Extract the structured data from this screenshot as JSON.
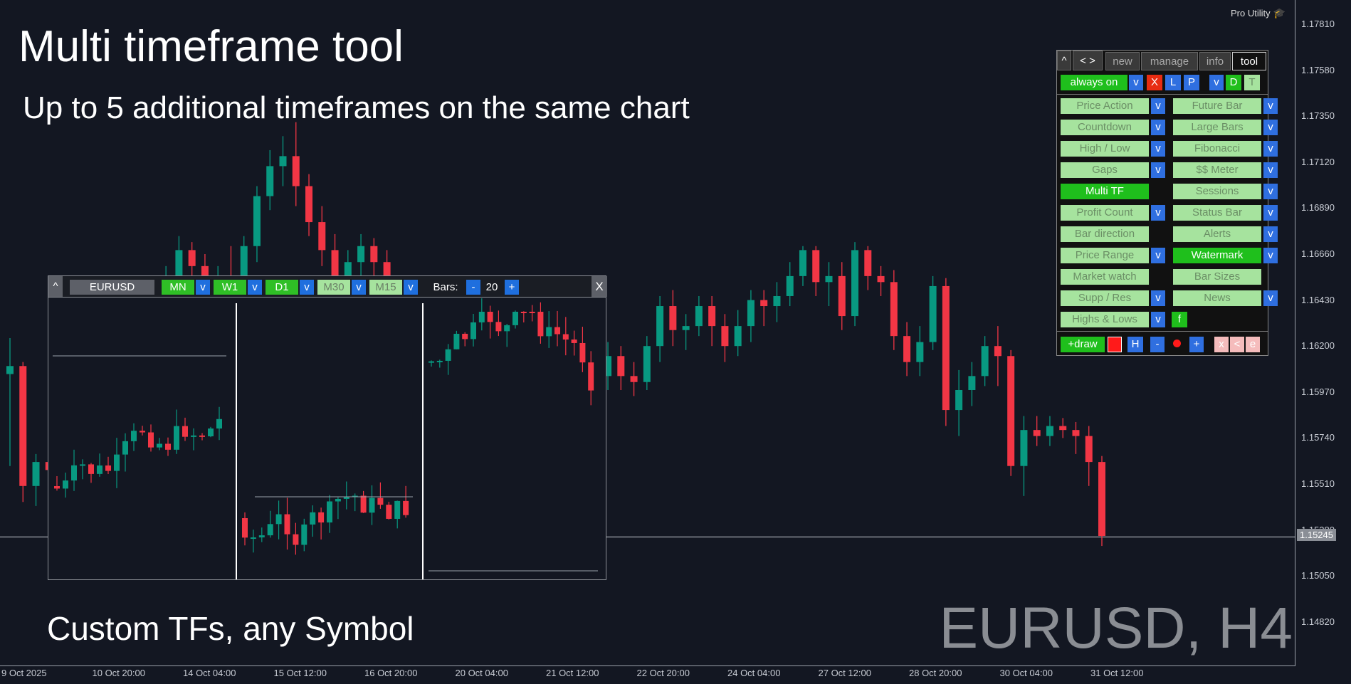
{
  "overlay": {
    "title": "Multi timeframe tool",
    "subtitle": "Up to 5 additional timeframes on the same chart",
    "caption": "Custom TFs, any Symbol",
    "watermark": "EURUSD, H4",
    "brand": "Pro Utility",
    "brand_icon": "graduation-cap-icon"
  },
  "price_axis": {
    "labels": [
      "1.17810",
      "1.17580",
      "1.17350",
      "1.17120",
      "1.16890",
      "1.16660",
      "1.16430",
      "1.16200",
      "1.15970",
      "1.15740",
      "1.15510",
      "1.15280",
      "1.15050",
      "1.14820"
    ],
    "current_price": "1.15245"
  },
  "time_axis": {
    "labels": [
      "9 Oct 2025",
      "10 Oct 20:00",
      "14 Oct 04:00",
      "15 Oct 12:00",
      "16 Oct 20:00",
      "20 Oct 04:00",
      "21 Oct 12:00",
      "22 Oct 20:00",
      "24 Oct 04:00",
      "27 Oct 12:00",
      "28 Oct 20:00",
      "30 Oct 04:00",
      "31 Oct 12:00"
    ]
  },
  "chart_data": {
    "type": "candlestick",
    "symbol": "EURUSD",
    "timeframe": "H4",
    "ylim": [
      1.147,
      1.18
    ],
    "current_price": 1.15245,
    "candles": [
      [
        1.1606,
        1.1624,
        1.156,
        1.161
      ],
      [
        1.161,
        1.1612,
        1.1542,
        1.155
      ],
      [
        1.155,
        1.1566,
        1.154,
        1.1562
      ],
      [
        1.1562,
        1.157,
        1.1552,
        1.1558
      ],
      [
        1.1558,
        1.1572,
        1.1555,
        1.1568
      ],
      [
        1.1568,
        1.1603,
        1.1565,
        1.16
      ],
      [
        1.16,
        1.1612,
        1.159,
        1.1595
      ],
      [
        1.1595,
        1.161,
        1.1596,
        1.1605
      ],
      [
        1.1605,
        1.162,
        1.1598,
        1.1612
      ],
      [
        1.1612,
        1.1628,
        1.1605,
        1.162
      ],
      [
        1.162,
        1.163,
        1.1612,
        1.1615
      ],
      [
        1.1615,
        1.164,
        1.161,
        1.1635
      ],
      [
        1.1635,
        1.166,
        1.1625,
        1.165
      ],
      [
        1.165,
        1.1675,
        1.164,
        1.1668
      ],
      [
        1.1668,
        1.1672,
        1.1645,
        1.166
      ],
      [
        1.166,
        1.1666,
        1.163,
        1.164
      ],
      [
        1.164,
        1.166,
        1.1635,
        1.1655
      ],
      [
        1.1655,
        1.167,
        1.1645,
        1.165
      ],
      [
        1.165,
        1.1675,
        1.1648,
        1.167
      ],
      [
        1.167,
        1.17,
        1.1662,
        1.1695
      ],
      [
        1.1695,
        1.1718,
        1.1688,
        1.171
      ],
      [
        1.171,
        1.1725,
        1.17,
        1.1715
      ],
      [
        1.1715,
        1.1732,
        1.169,
        1.17
      ],
      [
        1.17,
        1.1706,
        1.1675,
        1.1682
      ],
      [
        1.1682,
        1.169,
        1.166,
        1.1668
      ],
      [
        1.1668,
        1.1676,
        1.1645,
        1.165
      ],
      [
        1.165,
        1.1668,
        1.164,
        1.1662
      ],
      [
        1.1662,
        1.1676,
        1.165,
        1.167
      ],
      [
        1.167,
        1.1674,
        1.165,
        1.1662
      ],
      [
        1.1662,
        1.1668,
        1.1635,
        1.1642
      ],
      [
        1.1642,
        1.165,
        1.1622,
        1.163
      ],
      [
        1.163,
        1.164,
        1.161,
        1.1618
      ],
      [
        1.1618,
        1.1622,
        1.1592,
        1.16
      ],
      [
        1.16,
        1.1604,
        1.1578,
        1.1585
      ],
      [
        1.1585,
        1.159,
        1.156,
        1.1572
      ],
      [
        1.1572,
        1.158,
        1.155,
        1.156
      ],
      [
        1.156,
        1.1596,
        1.1555,
        1.159
      ],
      [
        1.159,
        1.1625,
        1.1585,
        1.162
      ],
      [
        1.162,
        1.1624,
        1.16,
        1.161
      ],
      [
        1.161,
        1.1616,
        1.1592,
        1.16
      ],
      [
        1.16,
        1.1605,
        1.1582,
        1.1592
      ],
      [
        1.1592,
        1.16,
        1.1575,
        1.1588
      ],
      [
        1.1588,
        1.1596,
        1.158,
        1.1592
      ],
      [
        1.1592,
        1.1604,
        1.1585,
        1.1598
      ],
      [
        1.1598,
        1.1615,
        1.1592,
        1.161
      ],
      [
        1.161,
        1.1616,
        1.1598,
        1.1605
      ],
      [
        1.1605,
        1.1622,
        1.1598,
        1.1615
      ],
      [
        1.1615,
        1.162,
        1.1598,
        1.1605
      ],
      [
        1.1605,
        1.1612,
        1.1595,
        1.1602
      ],
      [
        1.1602,
        1.1625,
        1.1598,
        1.162
      ],
      [
        1.162,
        1.1645,
        1.1612,
        1.164
      ],
      [
        1.164,
        1.1648,
        1.162,
        1.1628
      ],
      [
        1.1628,
        1.1636,
        1.1618,
        1.163
      ],
      [
        1.163,
        1.1645,
        1.1625,
        1.164
      ],
      [
        1.164,
        1.1645,
        1.162,
        1.163
      ],
      [
        1.163,
        1.1636,
        1.1612,
        1.162
      ],
      [
        1.162,
        1.1638,
        1.1615,
        1.163
      ],
      [
        1.163,
        1.1648,
        1.1622,
        1.1643
      ],
      [
        1.1643,
        1.1648,
        1.163,
        1.164
      ],
      [
        1.164,
        1.1652,
        1.1632,
        1.1645
      ],
      [
        1.1645,
        1.1662,
        1.164,
        1.1655
      ],
      [
        1.1655,
        1.167,
        1.165,
        1.1668
      ],
      [
        1.1668,
        1.167,
        1.1645,
        1.1652
      ],
      [
        1.1652,
        1.1662,
        1.164,
        1.1655
      ],
      [
        1.1655,
        1.1662,
        1.1628,
        1.1635
      ],
      [
        1.1635,
        1.1672,
        1.163,
        1.1668
      ],
      [
        1.1668,
        1.167,
        1.1648,
        1.1655
      ],
      [
        1.1655,
        1.166,
        1.1645,
        1.1652
      ],
      [
        1.1652,
        1.1658,
        1.1618,
        1.1625
      ],
      [
        1.1625,
        1.1632,
        1.1605,
        1.1612
      ],
      [
        1.1612,
        1.163,
        1.1605,
        1.1622
      ],
      [
        1.1622,
        1.1655,
        1.1618,
        1.165
      ],
      [
        1.165,
        1.1654,
        1.158,
        1.1588
      ],
      [
        1.1588,
        1.1608,
        1.1575,
        1.1598
      ],
      [
        1.1598,
        1.1612,
        1.159,
        1.1605
      ],
      [
        1.1605,
        1.1625,
        1.16,
        1.162
      ],
      [
        1.162,
        1.163,
        1.16,
        1.1615
      ],
      [
        1.1615,
        1.1618,
        1.1555,
        1.156
      ],
      [
        1.156,
        1.1585,
        1.1545,
        1.1578
      ],
      [
        1.1578,
        1.1585,
        1.157,
        1.1575
      ],
      [
        1.1575,
        1.1585,
        1.157,
        1.158
      ],
      [
        1.158,
        1.1584,
        1.1574,
        1.1578
      ],
      [
        1.1578,
        1.1582,
        1.1566,
        1.1575
      ],
      [
        1.1575,
        1.158,
        1.155,
        1.1562
      ],
      [
        1.1562,
        1.1565,
        1.152,
        1.1525
      ]
    ]
  },
  "mtf_window": {
    "symbol": "EURUSD",
    "bars_label": "Bars:",
    "bars_value": "20",
    "minus": "-",
    "plus": "+",
    "close": "X",
    "collapse": "^",
    "dropdown": "v",
    "timeframes": [
      {
        "label": "MN",
        "active": true
      },
      {
        "label": "W1",
        "active": true
      },
      {
        "label": "D1",
        "active": true
      },
      {
        "label": "M30",
        "active": false
      },
      {
        "label": "M15",
        "active": false
      }
    ]
  },
  "tool_panel": {
    "collapse": "^",
    "arrows": "< >",
    "tabs": [
      "new",
      "manage",
      "info",
      "tool"
    ],
    "active_tab": "tool",
    "always_on": "always on",
    "row2": {
      "v1": "v",
      "x": "X",
      "l": "L",
      "p": "P",
      "v2": "v",
      "d": "D",
      "t": "T"
    },
    "left": [
      {
        "label": "Price Action",
        "active": false,
        "dd": true
      },
      {
        "label": "Countdown",
        "active": false,
        "dd": true
      },
      {
        "label": "High / Low",
        "active": false,
        "dd": true
      },
      {
        "label": "Gaps",
        "active": false,
        "dd": true
      },
      {
        "label": "Multi TF",
        "active": true,
        "dd": false
      },
      {
        "label": "Profit Count",
        "active": false,
        "dd": true
      },
      {
        "label": "Bar direction",
        "active": false,
        "dd": false
      },
      {
        "label": "Price Range",
        "active": false,
        "dd": true
      },
      {
        "label": "Market watch",
        "active": false,
        "dd": false
      },
      {
        "label": "Supp / Res",
        "active": false,
        "dd": true
      },
      {
        "label": "Highs & Lows",
        "active": false,
        "dd": true
      }
    ],
    "right": [
      {
        "label": "Future Bar",
        "active": false,
        "dd": true
      },
      {
        "label": "Large Bars",
        "active": false,
        "dd": true
      },
      {
        "label": "Fibonacci",
        "active": false,
        "dd": true
      },
      {
        "label": "$$ Meter",
        "active": false,
        "dd": true
      },
      {
        "label": "Sessions",
        "active": false,
        "dd": true
      },
      {
        "label": "Status Bar",
        "active": false,
        "dd": true
      },
      {
        "label": "Alerts",
        "active": false,
        "dd": true
      },
      {
        "label": "Watermark",
        "active": true,
        "dd": true
      },
      {
        "label": "Bar Sizes",
        "active": false,
        "dd": false
      },
      {
        "label": "News",
        "active": false,
        "dd": true
      }
    ],
    "f_button": "f",
    "bottom": {
      "draw": "+draw",
      "h": "H",
      "minus": "-",
      "plus": "+",
      "x": "x",
      "lt": "<",
      "e": "e"
    },
    "dropdown": "v"
  },
  "colors": {
    "background": "#131722",
    "bull": "#089981",
    "bear": "#f23645",
    "grid": "#9aa0aa"
  }
}
